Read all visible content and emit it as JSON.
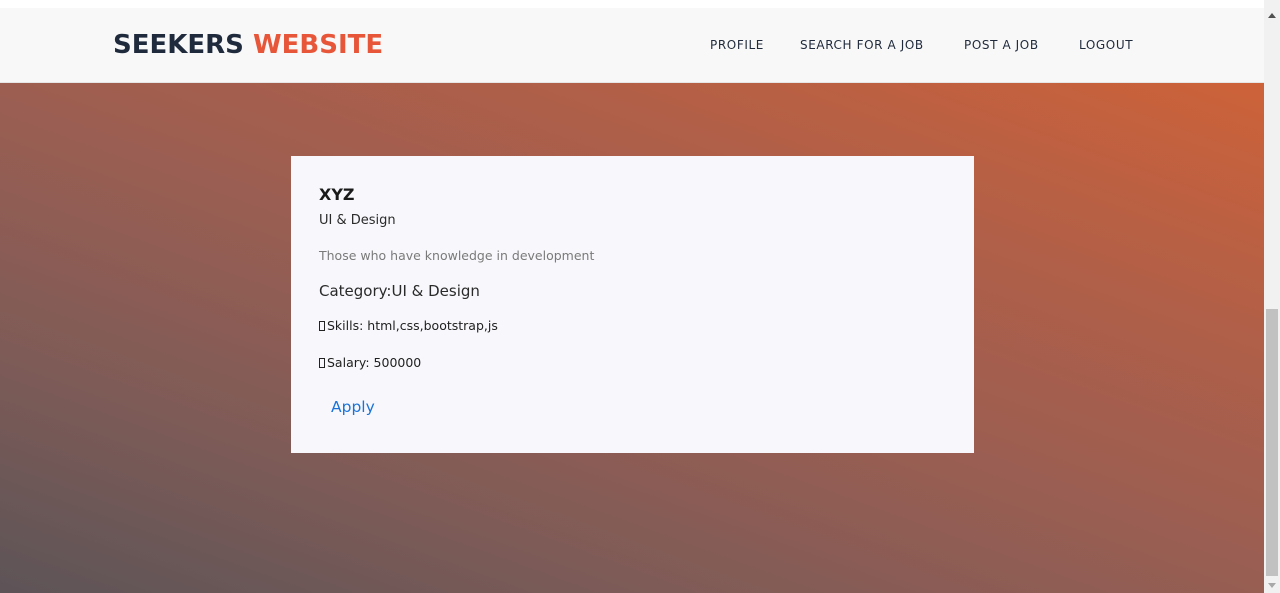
{
  "brand": {
    "part1": "SEEKERS",
    "part2": "WEBSITE",
    "dark_color": "#1f2a3c",
    "accent_color": "#e8563a"
  },
  "nav": {
    "items": [
      {
        "label": "PROFILE"
      },
      {
        "label": "SEARCH FOR A JOB"
      },
      {
        "label": "POST A JOB"
      },
      {
        "label": "LOGOUT"
      }
    ]
  },
  "job": {
    "title": "XYZ",
    "subtitle": "UI & Design",
    "description": "Those who have knowledge in development",
    "category": "Category:UI & Design",
    "skills": "Skills: html,css,bootstrap,js",
    "salary": "Salary: 500000",
    "apply_label": "Apply"
  },
  "colors": {
    "link": "#1a73d9",
    "card_bg": "#f8f8fc",
    "gradient_start": "#5d5457",
    "gradient_end": "#cd6239"
  }
}
